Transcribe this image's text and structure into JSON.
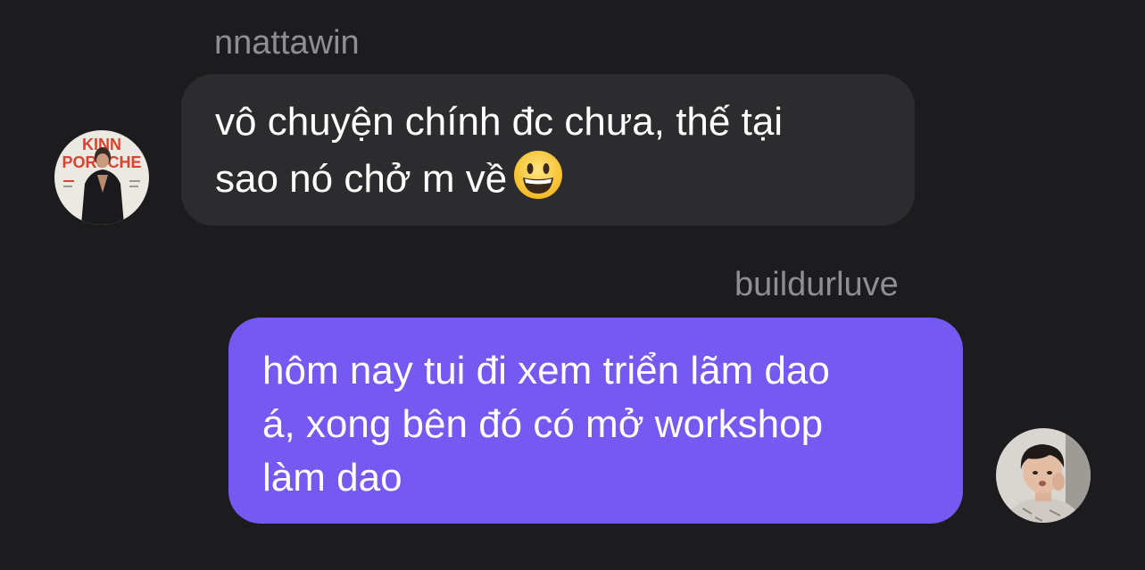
{
  "incoming": {
    "sender": "nnattawin",
    "line1": "vô chuyện chính đc chưa, thế tại",
    "line2": "sao nó chở m về",
    "emoji_name": "grinning-face-icon",
    "avatar_poster_text_top": "KINN",
    "avatar_poster_text_bottom": "PORSCHE"
  },
  "outgoing": {
    "sender": "buildurluve",
    "line1": "hôm nay tui đi xem triển lãm dao",
    "line2": "á, xong bên đó có mở workshop",
    "line3": "làm dao"
  },
  "colors": {
    "background": "#1c1c1e",
    "incoming_bubble": "#2c2c2e",
    "outgoing_bubble": "#7559f0",
    "sender_name": "#8e8e93"
  }
}
